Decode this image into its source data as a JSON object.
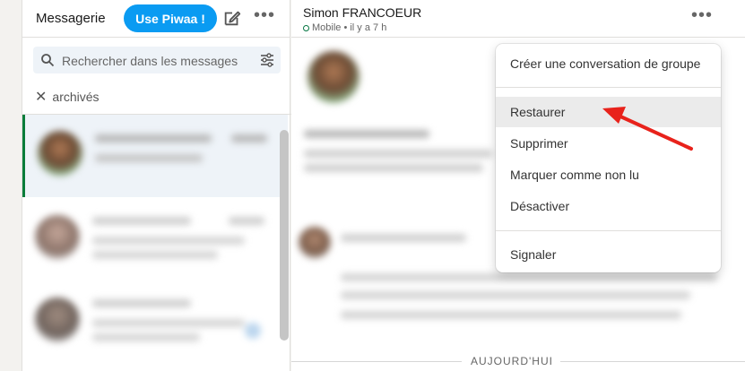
{
  "left_panel": {
    "title": "Messagerie",
    "piwaa_button": "Use Piwaa !",
    "search_placeholder": "Rechercher dans les messages",
    "archived_label": "archivés"
  },
  "conversation": {
    "name": "Simon FRANCOEUR",
    "status": "Mobile • il y a 7 h",
    "day_separator": "AUJOURD'HUI"
  },
  "menu": {
    "items": [
      "Créer une conversation de groupe",
      "Restaurer",
      "Supprimer",
      "Marquer comme non lu",
      "Désactiver",
      "Signaler"
    ],
    "highlighted": "Restaurer"
  },
  "colors": {
    "accent": "#0a9bf2",
    "online": "#057642",
    "arrow": "#e8221b"
  }
}
